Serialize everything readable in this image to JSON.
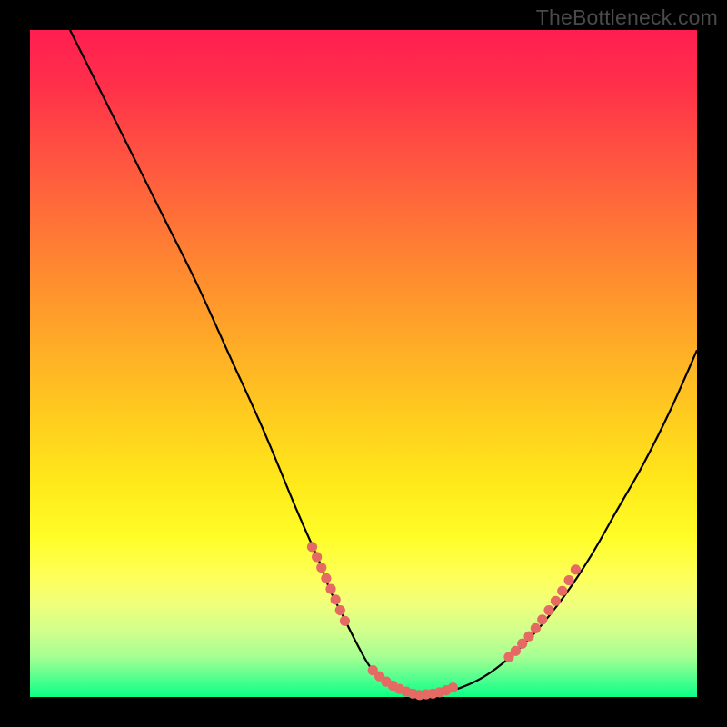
{
  "watermark": "TheBottleneck.com",
  "colors": {
    "background": "#000000",
    "gradient_top": "#ff1e50",
    "gradient_bottom": "#0aff86",
    "curve": "#000000",
    "dots": "#e46a63"
  },
  "chart_data": {
    "type": "line",
    "title": "",
    "xlabel": "",
    "ylabel": "",
    "xlim": [
      0,
      100
    ],
    "ylim": [
      0,
      100
    ],
    "series": [
      {
        "name": "bottleneck-curve",
        "x": [
          6,
          10,
          15,
          20,
          25,
          30,
          35,
          40,
          43.5,
          45,
          47,
          49,
          51,
          53,
          55,
          57,
          58.5,
          60,
          64,
          68,
          72,
          76,
          80,
          84,
          88,
          92,
          96,
          100
        ],
        "y": [
          100,
          92,
          82,
          72,
          62,
          51,
          40,
          28,
          20,
          16,
          12,
          8,
          4.5,
          2.5,
          1.3,
          0.6,
          0.3,
          0.4,
          1.2,
          3,
          6,
          10,
          15,
          21,
          28,
          35,
          43,
          52
        ]
      }
    ],
    "dot_clusters": [
      {
        "name": "left-segment",
        "points": [
          {
            "x": 42.3,
            "y": 22.5
          },
          {
            "x": 43.0,
            "y": 21.0
          },
          {
            "x": 43.7,
            "y": 19.4
          },
          {
            "x": 44.4,
            "y": 17.8
          },
          {
            "x": 45.1,
            "y": 16.2
          },
          {
            "x": 45.8,
            "y": 14.6
          },
          {
            "x": 46.5,
            "y": 13.0
          },
          {
            "x": 47.2,
            "y": 11.4
          }
        ]
      },
      {
        "name": "bottom-segment",
        "points": [
          {
            "x": 51.4,
            "y": 4.0
          },
          {
            "x": 52.4,
            "y": 3.1
          },
          {
            "x": 53.4,
            "y": 2.3
          },
          {
            "x": 54.4,
            "y": 1.7
          },
          {
            "x": 55.4,
            "y": 1.2
          },
          {
            "x": 56.4,
            "y": 0.8
          },
          {
            "x": 57.4,
            "y": 0.5
          },
          {
            "x": 58.4,
            "y": 0.3
          },
          {
            "x": 59.4,
            "y": 0.4
          },
          {
            "x": 60.4,
            "y": 0.5
          },
          {
            "x": 61.4,
            "y": 0.7
          },
          {
            "x": 62.4,
            "y": 1.0
          },
          {
            "x": 63.4,
            "y": 1.4
          }
        ]
      },
      {
        "name": "right-segment",
        "points": [
          {
            "x": 71.8,
            "y": 6.0
          },
          {
            "x": 72.8,
            "y": 6.9
          },
          {
            "x": 73.8,
            "y": 8.0
          },
          {
            "x": 74.8,
            "y": 9.1
          },
          {
            "x": 75.8,
            "y": 10.3
          },
          {
            "x": 76.8,
            "y": 11.6
          },
          {
            "x": 77.8,
            "y": 13.0
          },
          {
            "x": 78.8,
            "y": 14.4
          },
          {
            "x": 79.8,
            "y": 15.9
          },
          {
            "x": 80.8,
            "y": 17.5
          },
          {
            "x": 81.8,
            "y": 19.1
          }
        ]
      }
    ]
  }
}
